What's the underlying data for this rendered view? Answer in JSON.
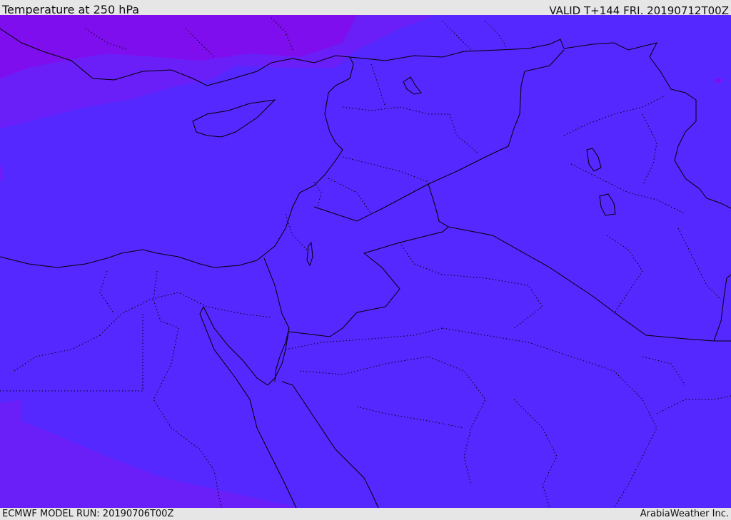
{
  "header": {
    "title": "Temperature at 250 hPa",
    "valid": "VALID T+144 FRI. 20190712T00Z"
  },
  "footer": {
    "model_run": "ECMWF MODEL RUN: 20190706T00Z",
    "credit": "ArabiaWeather Inc."
  },
  "map": {
    "field": "temperature",
    "level": "250 hPa",
    "colors": {
      "base": "#5528ff",
      "warm_band": "#6a1ff8",
      "warmest": "#7f0eee",
      "borders": "#000000"
    }
  }
}
